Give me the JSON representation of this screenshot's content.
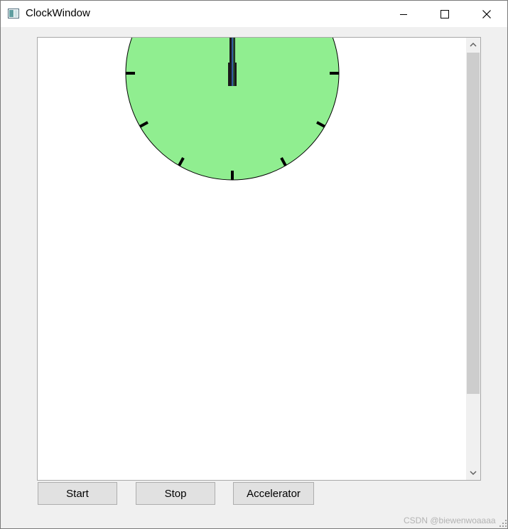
{
  "window": {
    "title": "ClockWindow"
  },
  "titlebar": {
    "minimize_icon": "minimize-icon",
    "maximize_icon": "maximize-icon",
    "close_icon": "close-icon"
  },
  "clock": {
    "face_color": "#90ee90",
    "outline_color": "#000000",
    "hand_color": "#2a4a8a",
    "tick_marks_visible": 9
  },
  "buttons": {
    "start_label": "Start",
    "stop_label": "Stop",
    "accelerator_label": "Accelerator"
  },
  "watermark": "CSDN @biewenwoaaaa"
}
